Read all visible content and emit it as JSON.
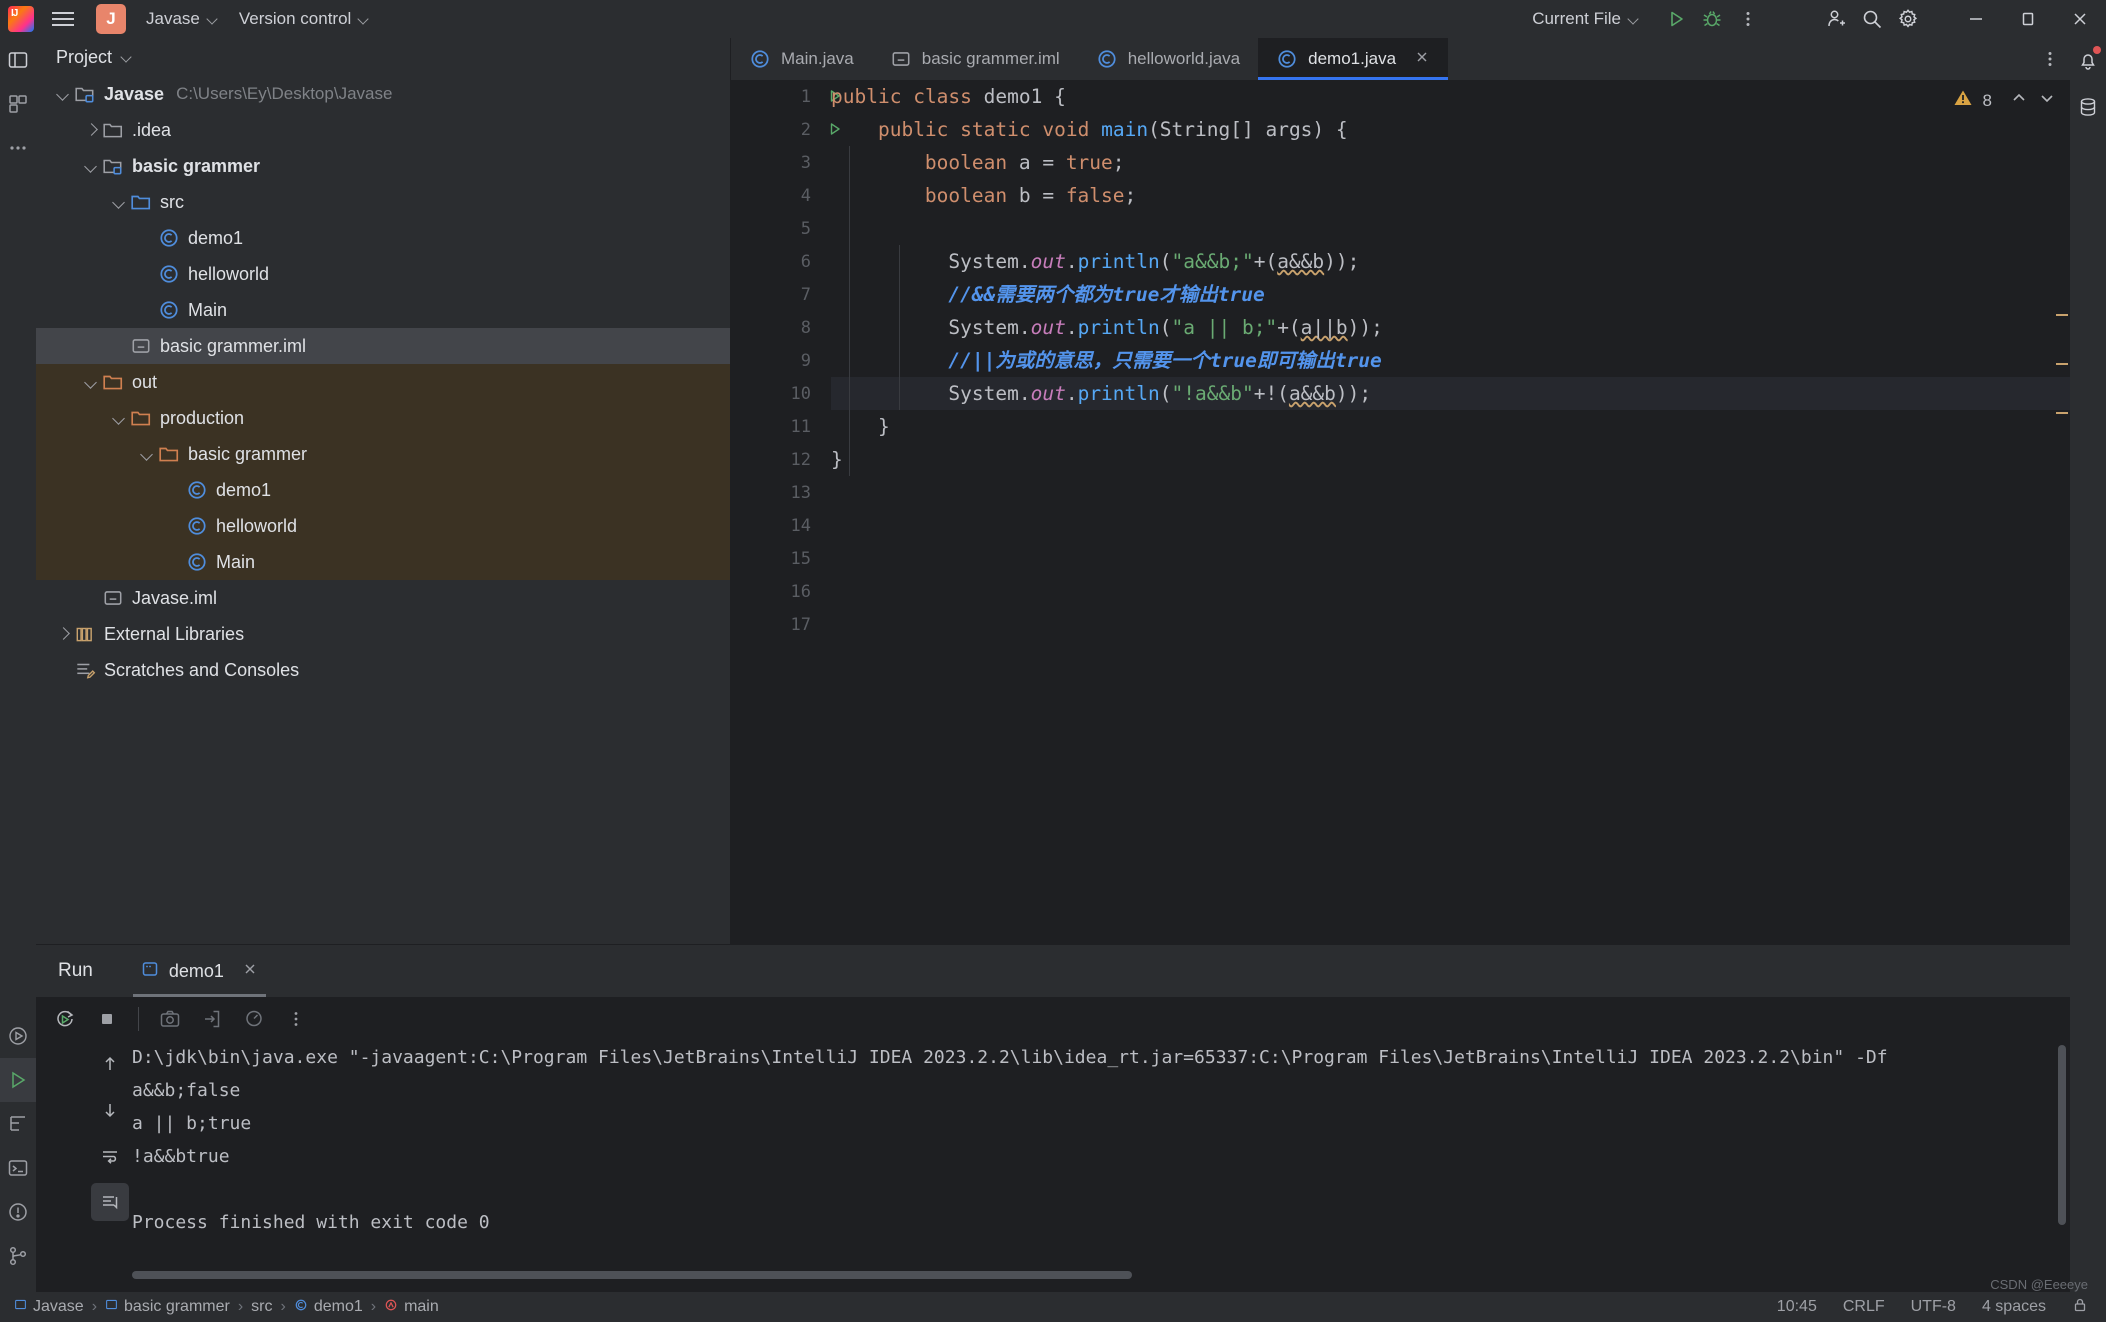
{
  "titlebar": {
    "menu_icon": "hamburger-icon",
    "project_badge": "J",
    "project_name": "Javase",
    "version_control": "Version control",
    "run_config": "Current File",
    "run_icon": "run-icon",
    "debug_icon": "debug-icon",
    "more_icon": "more-vertical-icon",
    "share_icon": "add-user-icon",
    "search_icon": "search-icon",
    "settings_icon": "gear-icon",
    "minimize": "minimize-icon",
    "maximize": "maximize-icon",
    "close": "close-icon"
  },
  "project_panel": {
    "title": "Project",
    "tree": [
      {
        "label": "Javase",
        "path": "C:\\Users\\Ey\\Desktop\\Javase",
        "indent": 0,
        "arrow": "down",
        "icon": "module-folder-icon",
        "bold": true
      },
      {
        "label": ".idea",
        "path": "",
        "indent": 1,
        "arrow": "right",
        "icon": "folder-icon",
        "bold": false
      },
      {
        "label": "basic grammer",
        "path": "",
        "indent": 1,
        "arrow": "down",
        "icon": "module-folder-icon",
        "bold": true
      },
      {
        "label": "src",
        "path": "",
        "indent": 2,
        "arrow": "down",
        "icon": "source-folder-icon",
        "bold": false
      },
      {
        "label": "demo1",
        "path": "",
        "indent": 3,
        "arrow": "none",
        "icon": "class-icon",
        "bold": false
      },
      {
        "label": "helloworld",
        "path": "",
        "indent": 3,
        "arrow": "none",
        "icon": "class-icon",
        "bold": false
      },
      {
        "label": "Main",
        "path": "",
        "indent": 3,
        "arrow": "none",
        "icon": "class-icon",
        "bold": false
      },
      {
        "label": "basic grammer.iml",
        "path": "",
        "indent": 2,
        "arrow": "none",
        "icon": "iml-icon",
        "bold": false,
        "selected": true
      },
      {
        "label": "out",
        "path": "",
        "indent": 1,
        "arrow": "down",
        "icon": "excluded-folder-icon",
        "bold": false,
        "out": true
      },
      {
        "label": "production",
        "path": "",
        "indent": 2,
        "arrow": "down",
        "icon": "excluded-folder-icon",
        "bold": false,
        "out": true
      },
      {
        "label": "basic grammer",
        "path": "",
        "indent": 3,
        "arrow": "down",
        "icon": "excluded-folder-icon",
        "bold": false,
        "out": true
      },
      {
        "label": "demo1",
        "path": "",
        "indent": 4,
        "arrow": "none",
        "icon": "class-icon",
        "bold": false,
        "out": true
      },
      {
        "label": "helloworld",
        "path": "",
        "indent": 4,
        "arrow": "none",
        "icon": "class-icon",
        "bold": false,
        "out": true
      },
      {
        "label": "Main",
        "path": "",
        "indent": 4,
        "arrow": "none",
        "icon": "class-icon",
        "bold": false,
        "out": true
      },
      {
        "label": "Javase.iml",
        "path": "",
        "indent": 1,
        "arrow": "none",
        "icon": "iml-icon",
        "bold": false
      },
      {
        "label": "External Libraries",
        "path": "",
        "indent": 0,
        "arrow": "right",
        "icon": "library-icon",
        "bold": false
      },
      {
        "label": "Scratches and Consoles",
        "path": "",
        "indent": 0,
        "arrow": "none",
        "icon": "scratches-icon",
        "bold": false
      }
    ]
  },
  "editor": {
    "tabs": [
      {
        "label": "Main.java",
        "icon": "class-icon",
        "active": false,
        "closable": false
      },
      {
        "label": "basic grammer.iml",
        "icon": "iml-icon",
        "active": false,
        "closable": false
      },
      {
        "label": "helloworld.java",
        "icon": "class-icon",
        "active": false,
        "closable": false
      },
      {
        "label": "demo1.java",
        "icon": "class-icon",
        "active": true,
        "closable": true
      }
    ],
    "tab_menu_icon": "more-vertical-icon",
    "warning_icon": "warning-triangle-icon",
    "warning_count": "8",
    "nav_up_icon": "chevron-up-icon",
    "nav_down_icon": "chevron-down-icon",
    "line_numbers": [
      "1",
      "2",
      "3",
      "4",
      "5",
      "6",
      "7",
      "8",
      "9",
      "10",
      "11",
      "12",
      "13",
      "14",
      "15",
      "16",
      "17"
    ],
    "run_gutter_lines": [
      1,
      2
    ],
    "highlight_line": 10,
    "code": [
      {
        "n": 1,
        "tokens": [
          {
            "t": "public",
            "c": "k"
          },
          {
            "t": " ",
            "c": "p"
          },
          {
            "t": "class",
            "c": "k"
          },
          {
            "t": " demo1 {",
            "c": "p"
          }
        ]
      },
      {
        "n": 2,
        "tokens": [
          {
            "t": "    ",
            "c": "p"
          },
          {
            "t": "public",
            "c": "k"
          },
          {
            "t": " ",
            "c": "p"
          },
          {
            "t": "static",
            "c": "k"
          },
          {
            "t": " ",
            "c": "p"
          },
          {
            "t": "void",
            "c": "k"
          },
          {
            "t": " ",
            "c": "p"
          },
          {
            "t": "main",
            "c": "m"
          },
          {
            "t": "(String[] args) {",
            "c": "p"
          }
        ]
      },
      {
        "n": 3,
        "tokens": [
          {
            "t": "        ",
            "c": "p"
          },
          {
            "t": "boolean",
            "c": "k"
          },
          {
            "t": " a = ",
            "c": "p"
          },
          {
            "t": "true",
            "c": "k"
          },
          {
            "t": ";",
            "c": "p"
          }
        ]
      },
      {
        "n": 4,
        "tokens": [
          {
            "t": "        ",
            "c": "p"
          },
          {
            "t": "boolean",
            "c": "k"
          },
          {
            "t": " b = ",
            "c": "p"
          },
          {
            "t": "false",
            "c": "k"
          },
          {
            "t": ";",
            "c": "p"
          }
        ]
      },
      {
        "n": 5,
        "tokens": []
      },
      {
        "n": 6,
        "tokens": [
          {
            "t": "          System.",
            "c": "p"
          },
          {
            "t": "out",
            "c": "f"
          },
          {
            "t": ".",
            "c": "p"
          },
          {
            "t": "println",
            "c": "m"
          },
          {
            "t": "(",
            "c": "p"
          },
          {
            "t": "\"a&&b;\"",
            "c": "s"
          },
          {
            "t": "+(",
            "c": "p"
          },
          {
            "t": "a&&b",
            "c": "err"
          },
          {
            "t": "));",
            "c": "p"
          }
        ]
      },
      {
        "n": 7,
        "tokens": [
          {
            "t": "          //&&需要两个都为true才输出true",
            "c": "cm"
          }
        ]
      },
      {
        "n": 8,
        "tokens": [
          {
            "t": "          System.",
            "c": "p"
          },
          {
            "t": "out",
            "c": "f"
          },
          {
            "t": ".",
            "c": "p"
          },
          {
            "t": "println",
            "c": "m"
          },
          {
            "t": "(",
            "c": "p"
          },
          {
            "t": "\"a || b;\"",
            "c": "s"
          },
          {
            "t": "+(",
            "c": "p"
          },
          {
            "t": "a||b",
            "c": "err"
          },
          {
            "t": "));",
            "c": "p"
          }
        ]
      },
      {
        "n": 9,
        "tokens": [
          {
            "t": "          //||为或的意思，只需要一个true即可输出true",
            "c": "cm"
          }
        ]
      },
      {
        "n": 10,
        "tokens": [
          {
            "t": "          System.",
            "c": "p"
          },
          {
            "t": "out",
            "c": "f"
          },
          {
            "t": ".",
            "c": "p"
          },
          {
            "t": "println",
            "c": "m"
          },
          {
            "t": "(",
            "c": "p"
          },
          {
            "t": "\"!a&&b\"",
            "c": "s"
          },
          {
            "t": "+!(",
            "c": "p"
          },
          {
            "t": "a&&b",
            "c": "err"
          },
          {
            "t": "));",
            "c": "p"
          }
        ]
      },
      {
        "n": 11,
        "tokens": [
          {
            "t": "    }",
            "c": "p"
          }
        ]
      },
      {
        "n": 12,
        "tokens": [
          {
            "t": "}",
            "c": "p"
          }
        ]
      },
      {
        "n": 13,
        "tokens": []
      },
      {
        "n": 14,
        "tokens": []
      },
      {
        "n": 15,
        "tokens": []
      },
      {
        "n": 16,
        "tokens": []
      },
      {
        "n": 17,
        "tokens": []
      }
    ]
  },
  "run_panel": {
    "title": "Run",
    "tab_label": "demo1",
    "tab_icon": "run-config-icon",
    "tab_close_icon": "close-icon",
    "toolbar": [
      {
        "name": "rerun-icon",
        "active": false
      },
      {
        "name": "stop-icon",
        "active": false
      },
      {
        "name": "screenshot-icon",
        "active": false
      },
      {
        "name": "dump-threads-icon",
        "active": false
      },
      {
        "name": "profiler-icon",
        "active": false
      },
      {
        "name": "more-vertical-icon",
        "active": false
      }
    ],
    "side_toolbar": [
      {
        "name": "arrow-up-icon",
        "active": false
      },
      {
        "name": "arrow-down-icon",
        "active": false
      },
      {
        "name": "soft-wrap-icon",
        "active": false
      },
      {
        "name": "scroll-to-end-icon",
        "active": true
      }
    ],
    "console": [
      "D:\\jdk\\bin\\java.exe \"-javaagent:C:\\Program Files\\JetBrains\\IntelliJ IDEA 2023.2.2\\lib\\idea_rt.jar=65337:C:\\Program Files\\JetBrains\\IntelliJ IDEA 2023.2.2\\bin\" -Df",
      "a&&b;false",
      "a || b;true",
      "!a&&btrue",
      "",
      "Process finished with exit code 0"
    ]
  },
  "status_bar": {
    "breadcrumbs": [
      {
        "label": "Javase",
        "icon": "module-icon"
      },
      {
        "label": "basic grammer",
        "icon": "module-icon"
      },
      {
        "label": "src",
        "icon": "none"
      },
      {
        "label": "demo1",
        "icon": "class-icon"
      },
      {
        "label": "main",
        "icon": "method-icon"
      }
    ],
    "time": "10:45",
    "line_sep": "CRLF",
    "encoding": "UTF-8",
    "indent": "4 spaces",
    "lock_icon": "lock-icon",
    "watermark": "CSDN @Eeeeye"
  },
  "left_rail": [
    {
      "name": "project-tool-icon",
      "active": true
    },
    {
      "name": "commit-tool-icon",
      "active": false
    },
    {
      "name": "more-tools-icon",
      "active": false
    },
    {
      "name": "run-tool-icon",
      "active": false
    },
    {
      "name": "run-panel-icon",
      "active": true
    },
    {
      "name": "structure-tool-icon",
      "active": false
    },
    {
      "name": "terminal-tool-icon",
      "active": false
    },
    {
      "name": "problems-tool-icon",
      "active": false
    },
    {
      "name": "version-control-icon",
      "active": false
    },
    {
      "name": "expand-icon",
      "active": false
    }
  ],
  "right_rail": [
    {
      "name": "notifications-icon",
      "badge": true
    },
    {
      "name": "database-icon",
      "badge": false
    }
  ],
  "colors": {
    "accent": "#3574f0",
    "panel_bg": "#2b2d30",
    "editor_bg": "#1e1f22",
    "excluded_bg": "#3b3223",
    "warning": "#d9a343",
    "keyword": "#cf8e6d",
    "string": "#6aab73",
    "comment": "#5394ec",
    "method": "#56a8f5",
    "static_field": "#c77dbb"
  }
}
